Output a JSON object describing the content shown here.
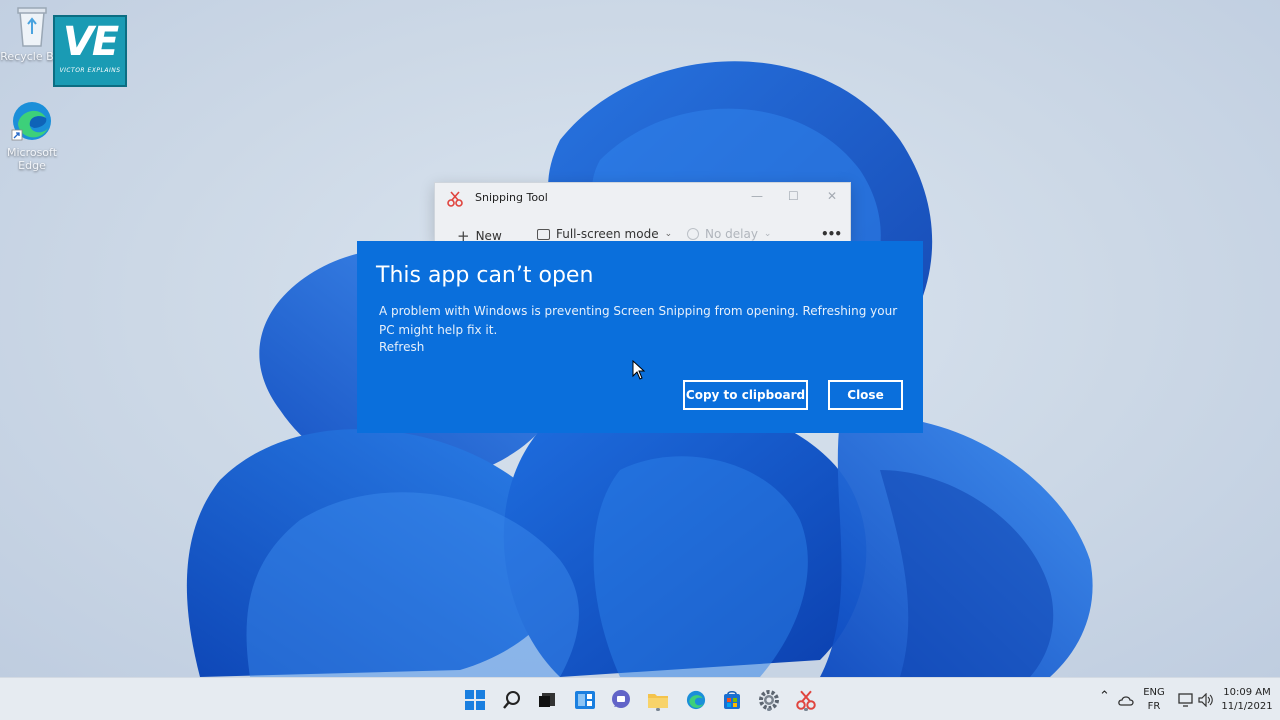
{
  "desktop": {
    "watermark": {
      "big": "VE",
      "small": "VICTOR EXPLAINS"
    },
    "icons": [
      {
        "label": "Recycle Bin"
      },
      {
        "label": "Microsoft Edge"
      }
    ]
  },
  "snipping_tool": {
    "title": "Snipping Tool",
    "toolbar": {
      "new_label": "New",
      "mode_label": "Full-screen mode",
      "delay_label": "No delay",
      "more": "•••"
    }
  },
  "dialog": {
    "title": "This app can’t open",
    "message": "A problem with Windows is preventing Screen Snipping from opening. Refreshing your PC might help fix it.",
    "refresh_link": "Refresh",
    "copy_button": "Copy to clipboard",
    "close_button": "Close",
    "background_color": "#0a6fdc"
  },
  "taskbar": {
    "apps": [
      "start",
      "search",
      "task-view",
      "widgets",
      "teams-chat",
      "file-explorer",
      "edge",
      "store",
      "settings",
      "snipping-tool"
    ],
    "tray": {
      "language_top": "ENG",
      "language_bottom": "FR",
      "time": "10:09 AM",
      "date": "11/1/2021"
    }
  }
}
